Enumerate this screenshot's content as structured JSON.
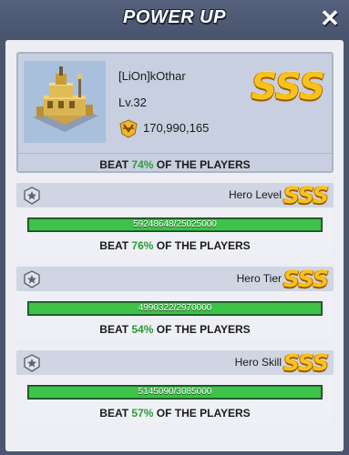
{
  "header": {
    "title": "POWER UP",
    "close_icon": "close-icon"
  },
  "summary": {
    "player_name": "[LiOn]kOthar",
    "level": "Lv.32",
    "power": "170,990,165",
    "grade": "SSS",
    "beat_prefix": "BEAT",
    "beat_percent": "74%",
    "beat_suffix": "OF THE PLAYERS"
  },
  "sections": [
    {
      "label": "Hero Level",
      "grade": "SSS",
      "progress_text": "59248648/25025000",
      "progress_fraction": 1.0,
      "beat_prefix": "BEAT",
      "beat_percent": "76%",
      "beat_suffix": "OF THE PLAYERS",
      "icon": "medal-icon"
    },
    {
      "label": "Hero Tier",
      "grade": "SSS",
      "progress_text": "4990322/2970000",
      "progress_fraction": 1.0,
      "beat_prefix": "BEAT",
      "beat_percent": "54%",
      "beat_suffix": "OF THE PLAYERS",
      "icon": "medal-icon"
    },
    {
      "label": "Hero Skill",
      "grade": "SSS",
      "progress_text": "5145090/3085000",
      "progress_fraction": 1.0,
      "beat_prefix": "BEAT",
      "beat_percent": "57%",
      "beat_suffix": "OF THE PLAYERS",
      "icon": "medal-icon"
    }
  ],
  "colors": {
    "accent_green": "#3ec24a",
    "grade_gold": "#f8c21c",
    "header_bg": "#4a5670"
  }
}
